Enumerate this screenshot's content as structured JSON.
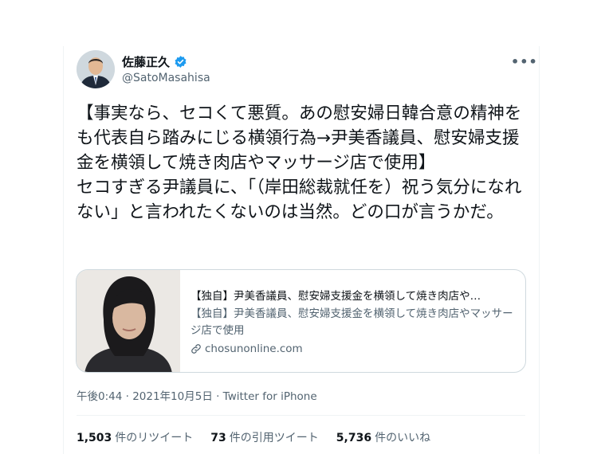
{
  "author": {
    "name": "佐藤正久",
    "handle": "@SatoMasahisa"
  },
  "more_label": "•••",
  "tweet_text": "【事実なら、セコくて悪質。あの慰安婦日韓合意の精神をも代表自ら踏みにじる横領行為→尹美香議員、慰安婦支援金を横領して焼き肉店やマッサージ店で使用】\nセコすぎる尹議員に、「（岸田総裁就任を）祝う気分になれない」と言われたくないのは当然。どの口が言うかだ。",
  "link_card": {
    "title": "【独自】尹美香議員、慰安婦支援金を横領して焼き肉店や…",
    "description": "【独自】尹美香議員、慰安婦支援金を横領して焼き肉店やマッサージ店で使用",
    "domain": "chosunonline.com"
  },
  "meta": "午後0:44 · 2021年10月5日 · Twitter for iPhone",
  "stats": {
    "retweets": {
      "count": "1,503",
      "label": "件のリツイート"
    },
    "quotes": {
      "count": "73",
      "label": "件の引用ツイート"
    },
    "likes": {
      "count": "5,736",
      "label": "件のいいね"
    }
  },
  "colors": {
    "text": "#0f1419",
    "secondary": "#536471",
    "verified": "#1d9bf0",
    "border": "#cfd9de"
  }
}
